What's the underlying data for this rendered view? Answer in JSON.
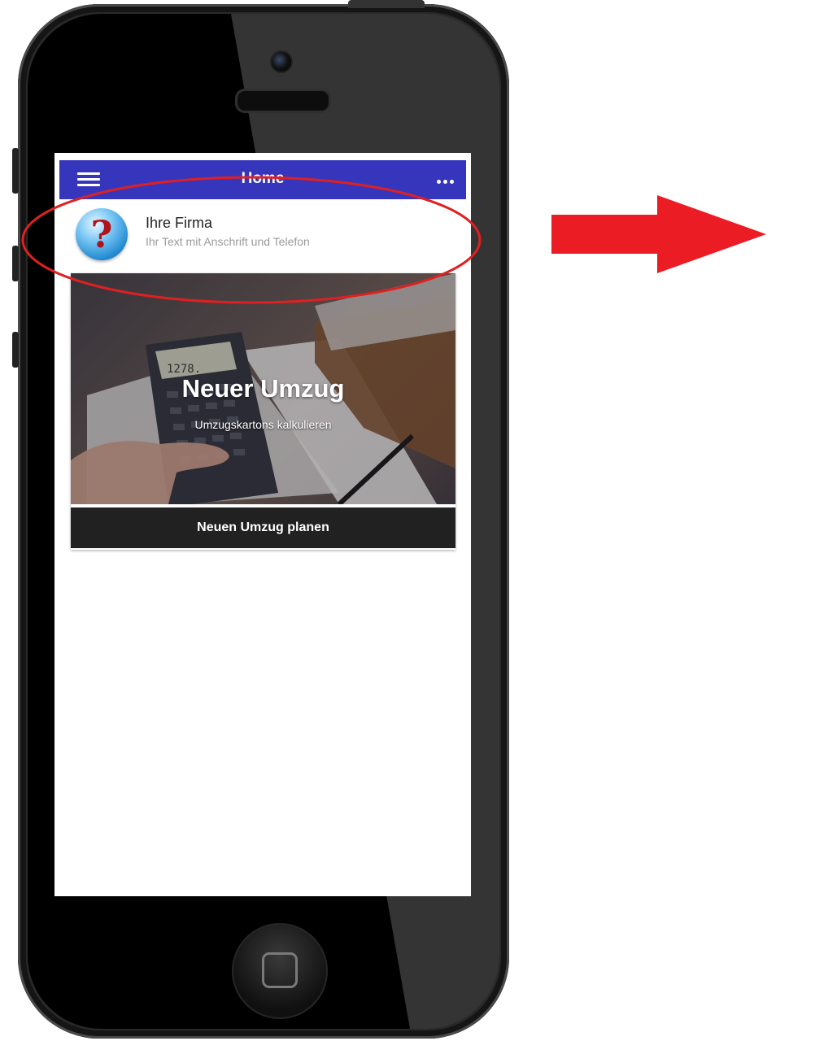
{
  "appbar": {
    "title": "Home",
    "menu_icon": "hamburger-menu-icon",
    "more_icon": "more-dots-icon"
  },
  "company": {
    "name": "Ihre Firma",
    "subtitle": "Ihr Text mit Anschrift und Telefon",
    "icon": "question-mark-icon",
    "icon_glyph": "?"
  },
  "card": {
    "title": "Neuer Umzug",
    "subtitle": "Umzugskartons kalkulieren",
    "button_label": "Neuen Umzug planen",
    "display_value": "1278.",
    "image": "calculator-photo"
  },
  "colors": {
    "appbar": "#3636bd",
    "button": "#212121",
    "annotation": "#e02020",
    "arrow": "#ec1c24"
  }
}
